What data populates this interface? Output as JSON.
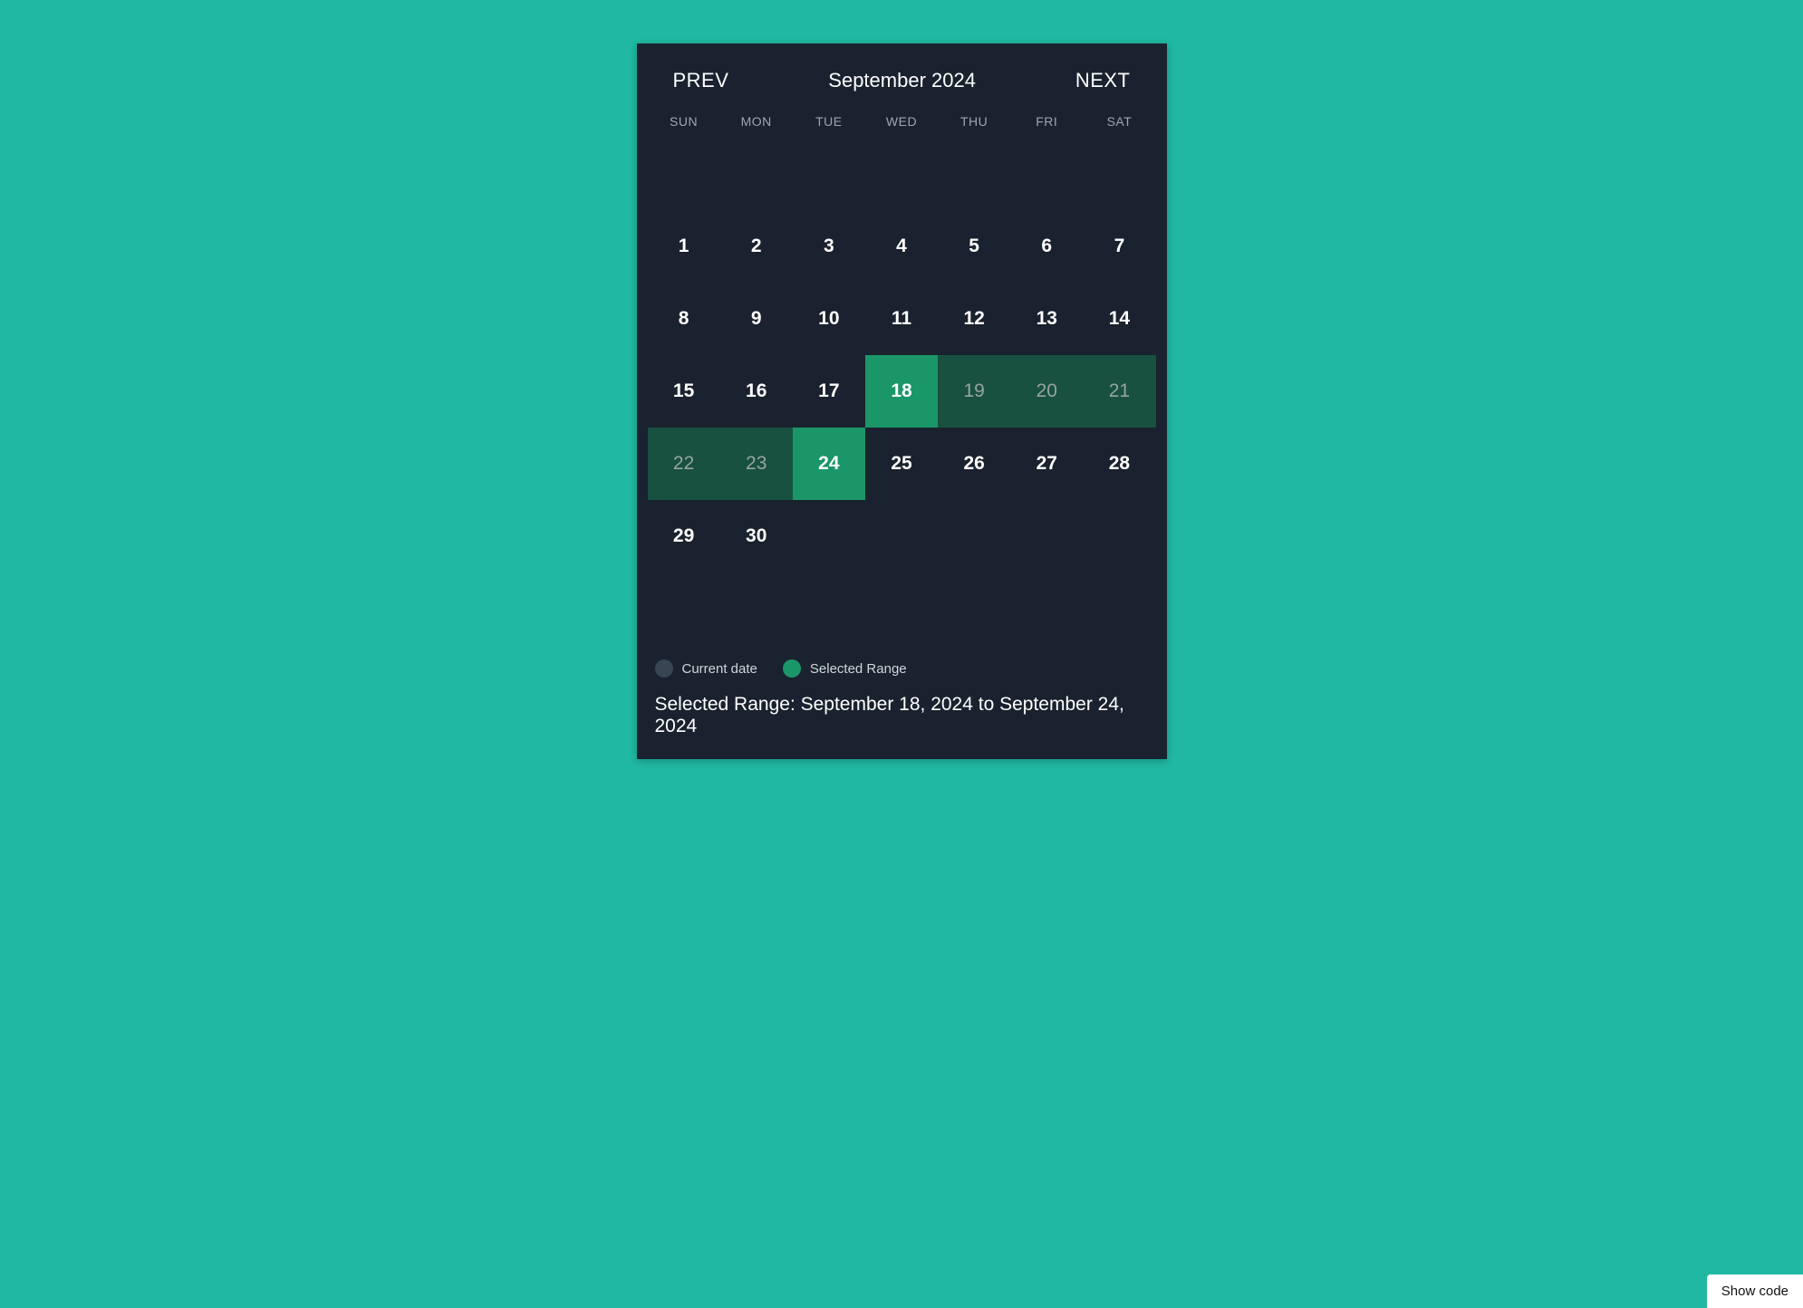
{
  "header": {
    "prev_label": "PREV",
    "next_label": "NEXT",
    "month_title": "September 2024"
  },
  "weekdays": [
    "SUN",
    "MON",
    "TUE",
    "WED",
    "THU",
    "FRI",
    "SAT"
  ],
  "days": [
    {
      "n": "",
      "state": "empty"
    },
    {
      "n": "",
      "state": "empty"
    },
    {
      "n": "",
      "state": "empty"
    },
    {
      "n": "",
      "state": "empty"
    },
    {
      "n": "",
      "state": "empty"
    },
    {
      "n": "",
      "state": "empty"
    },
    {
      "n": "",
      "state": "empty"
    },
    {
      "n": "1",
      "state": ""
    },
    {
      "n": "2",
      "state": ""
    },
    {
      "n": "3",
      "state": ""
    },
    {
      "n": "4",
      "state": ""
    },
    {
      "n": "5",
      "state": ""
    },
    {
      "n": "6",
      "state": ""
    },
    {
      "n": "7",
      "state": ""
    },
    {
      "n": "8",
      "state": ""
    },
    {
      "n": "9",
      "state": ""
    },
    {
      "n": "10",
      "state": ""
    },
    {
      "n": "11",
      "state": ""
    },
    {
      "n": "12",
      "state": ""
    },
    {
      "n": "13",
      "state": ""
    },
    {
      "n": "14",
      "state": ""
    },
    {
      "n": "15",
      "state": ""
    },
    {
      "n": "16",
      "state": ""
    },
    {
      "n": "17",
      "state": ""
    },
    {
      "n": "18",
      "state": "range-end"
    },
    {
      "n": "19",
      "state": "in-range"
    },
    {
      "n": "20",
      "state": "in-range"
    },
    {
      "n": "21",
      "state": "in-range"
    },
    {
      "n": "22",
      "state": "in-range"
    },
    {
      "n": "23",
      "state": "in-range"
    },
    {
      "n": "24",
      "state": "range-end"
    },
    {
      "n": "25",
      "state": ""
    },
    {
      "n": "26",
      "state": ""
    },
    {
      "n": "27",
      "state": ""
    },
    {
      "n": "28",
      "state": ""
    },
    {
      "n": "29",
      "state": ""
    },
    {
      "n": "30",
      "state": ""
    }
  ],
  "legend": {
    "current_label": "Current date",
    "selected_label": "Selected Range"
  },
  "selected_range_text": "Selected Range: September 18, 2024 to September 24, 2024",
  "show_code_label": "Show code"
}
